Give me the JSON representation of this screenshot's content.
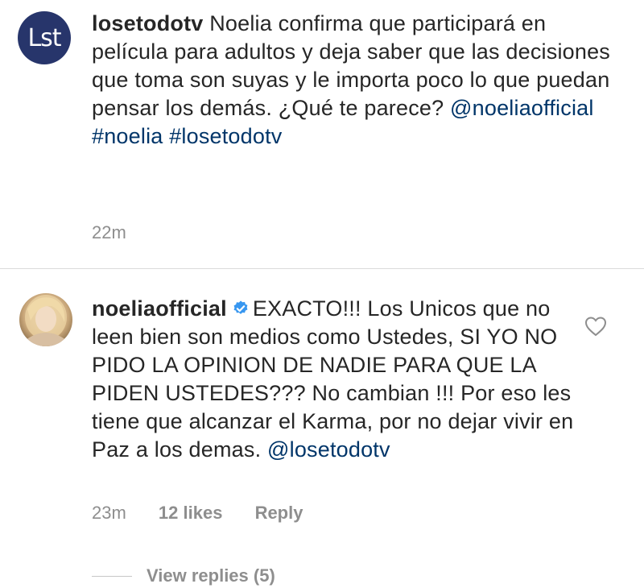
{
  "post": {
    "avatar_text": "Lst",
    "username": "losetodotv",
    "caption_text": "Noelia confirma que participará en película para adultos y deja saber que las decisiones que toma son suyas y le importa poco lo que puedan pensar los demás. ¿Qué te parece?",
    "mention": "@noeliaofficial",
    "hashtag_1": "#noelia",
    "hashtag_2": "#losetodotv",
    "time": "22m"
  },
  "comment": {
    "username": "noeliaofficial",
    "text": "EXACTO!!! Los Unicos que no leen bien son medios como Ustedes, SI YO NO PIDO LA OPINION DE NADIE PARA QUE LA PIDEN USTEDES??? No cambian !!! Por eso les tiene que alcanzar el Karma, por no dejar vivir en Paz a los demas.",
    "mention": "@losetodotv",
    "time": "23m",
    "likes": "12 likes",
    "reply_label": "Reply",
    "view_replies": "View replies (5)"
  },
  "colors": {
    "link": "#003569",
    "muted": "#8e8e8e",
    "verified": "#3897f0",
    "avatar_bg": "#27356b"
  }
}
